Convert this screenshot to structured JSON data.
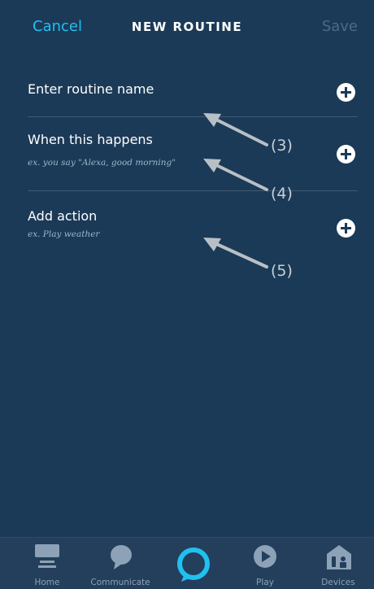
{
  "header": {
    "cancel_label": "Cancel",
    "title": "NEW ROUTINE",
    "save_label": "Save"
  },
  "rows": {
    "name": {
      "title": "Enter routine name"
    },
    "trigger": {
      "title": "When this happens",
      "hint": "ex. you say \"Alexa, good morning\""
    },
    "action": {
      "title": "Add action",
      "hint": "ex. Play weather"
    }
  },
  "annotations": [
    "(3)",
    "(4)",
    "(5)"
  ],
  "tabs": [
    {
      "label": "Home",
      "icon": "home-icon"
    },
    {
      "label": "Communicate",
      "icon": "speech-bubble-icon"
    },
    {
      "label": "",
      "icon": "alexa-ring-icon"
    },
    {
      "label": "Play",
      "icon": "play-icon"
    },
    {
      "label": "Devices",
      "icon": "devices-icon"
    }
  ],
  "colors": {
    "background": "#1b3a57",
    "accent": "#20c0f0",
    "disabled": "#4d6a84",
    "tabbar": "#233f5b"
  }
}
